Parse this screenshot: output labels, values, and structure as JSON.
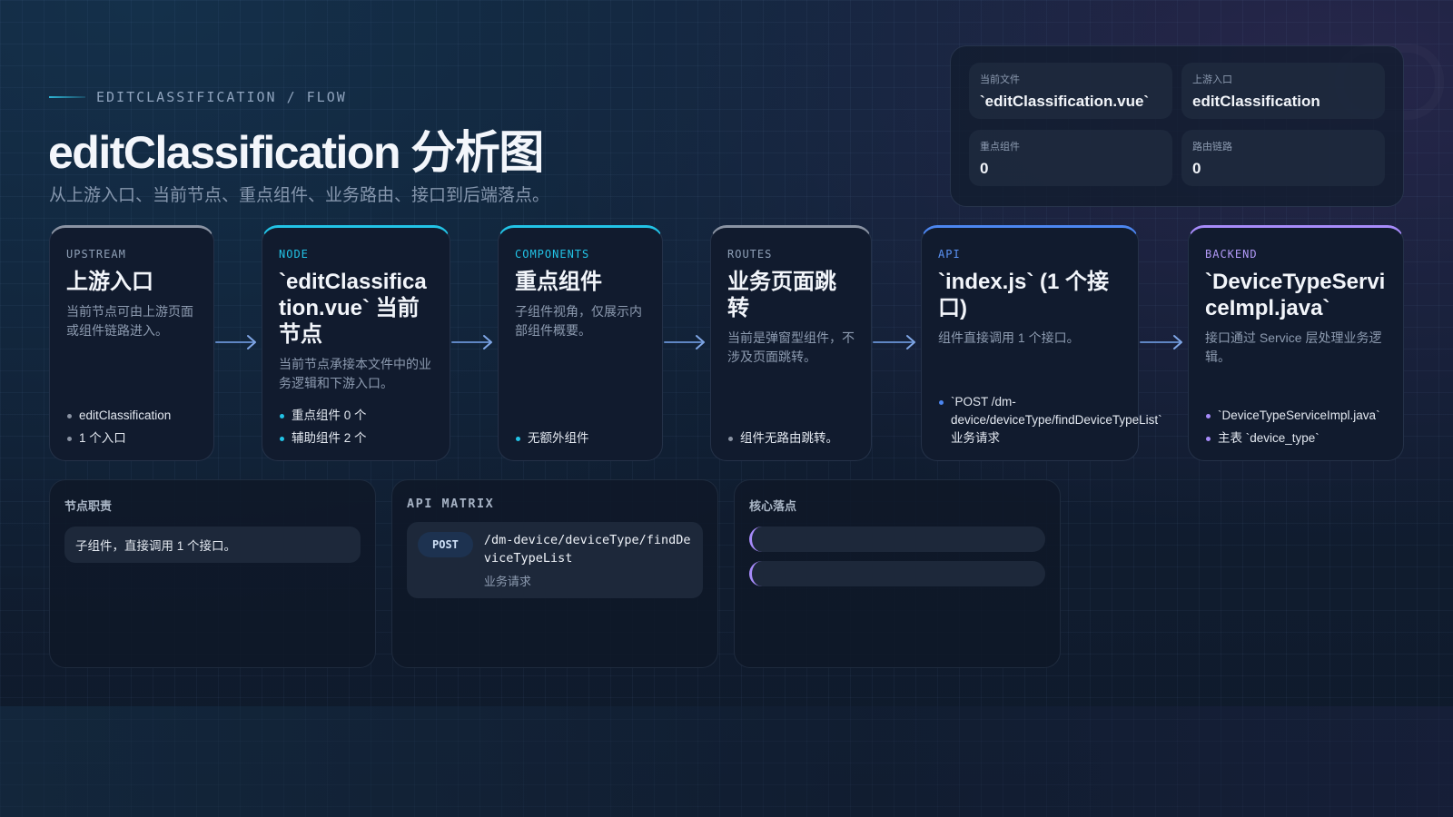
{
  "header": {
    "eyebrow": "EDITCLASSIFICATION / FLOW",
    "title": "editClassification 分析图",
    "subtitle": "从上游入口、当前节点、重点组件、业务路由、接口到后端落点。"
  },
  "summary": [
    {
      "label": "当前文件",
      "value": "`editClassification.vue`"
    },
    {
      "label": "上游入口",
      "value": "editClassification"
    },
    {
      "label": "重点组件",
      "value": "0"
    },
    {
      "label": "路由链路",
      "value": "0"
    }
  ],
  "stages": [
    {
      "tag": "UPSTREAM",
      "title": "上游入口",
      "desc": "当前节点可由上游页面或组件链路进入。",
      "accent": "#8a93a3",
      "tag_color": "#8fa0b7",
      "items": [
        "editClassification",
        "1 个入口"
      ]
    },
    {
      "tag": "NODE",
      "title": "`editClassification.vue` 当前节点",
      "desc": "当前节点承接本文件中的业务逻辑和下游入口。",
      "accent": "#22c3e6",
      "tag_color": "#22c3e6",
      "items": [
        "重点组件 0 个",
        "辅助组件 2 个"
      ]
    },
    {
      "tag": "COMPONENTS",
      "title": "重点组件",
      "desc": "子组件视角，仅展示内部组件概要。",
      "accent": "#22c3e6",
      "tag_color": "#22c3e6",
      "items": [
        "无额外组件"
      ]
    },
    {
      "tag": "ROUTES",
      "title": "业务页面跳转",
      "desc": "当前是弹窗型组件，不涉及页面跳转。",
      "accent": "#8a93a3",
      "tag_color": "#8fa0b7",
      "items": [
        "组件无路由跳转。"
      ]
    },
    {
      "tag": "API",
      "title": "`index.js` (1 个接口)",
      "desc": "组件直接调用 1 个接口。",
      "accent": "#4c86f0",
      "tag_color": "#5b93f5",
      "items": [
        "`POST /dm-device/deviceType/findDeviceTypeList` 业务请求"
      ]
    },
    {
      "tag": "BACKEND",
      "title": "`DeviceTypeServiceImpl.java`",
      "desc": "接口通过 Service 层处理业务逻辑。",
      "accent": "#a78bfa",
      "tag_color": "#b29af7",
      "items": [
        "`DeviceTypeServiceImpl.java`",
        "主表 `device_type`"
      ]
    }
  ],
  "panels": {
    "duty": {
      "heading": "节点职责",
      "text": "子组件，直接调用 1 个接口。"
    },
    "api_matrix": {
      "heading": "API MATRIX",
      "method": "POST",
      "path": "/dm-device/deviceType/findDeviceTypeList",
      "note": "业务请求"
    },
    "landing": {
      "heading": "核心落点",
      "bars": [
        "",
        ""
      ]
    }
  }
}
